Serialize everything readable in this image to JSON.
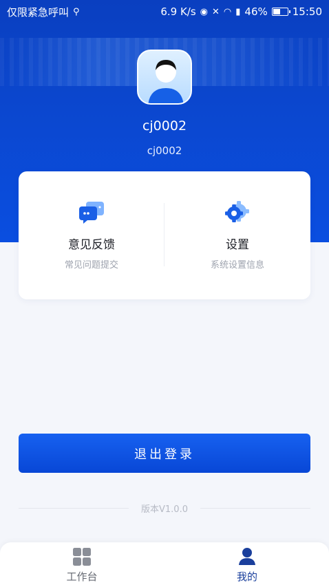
{
  "status_bar": {
    "carrier": "仅限紧急呼叫",
    "network_speed": "6.9 K/s",
    "battery": "46%",
    "time": "15:50"
  },
  "profile": {
    "name": "cj0002",
    "account": "cj0002"
  },
  "quick_actions": [
    {
      "title": "意见反馈",
      "subtitle": "常见问题提交",
      "icon": "feedback-chat-icon"
    },
    {
      "title": "设置",
      "subtitle": "系统设置信息",
      "icon": "gear-icon"
    }
  ],
  "logout_button": {
    "label": "退出登录"
  },
  "version": {
    "text": "版本V1.0.0"
  },
  "tabs": [
    {
      "label": "工作台",
      "icon": "grid-icon",
      "active": false
    },
    {
      "label": "我的",
      "icon": "person-icon",
      "active": true
    }
  ],
  "colors": {
    "primary": "#0b4ad6",
    "tab_active": "#1a3f9c",
    "tab_inactive": "#666a73",
    "text_primary": "#1d1f26",
    "text_secondary": "#9ea3ae"
  }
}
